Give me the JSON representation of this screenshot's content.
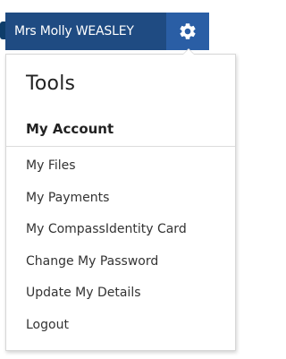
{
  "header": {
    "user_name": "Mrs Molly WEASLEY",
    "settings_icon": "gear-icon"
  },
  "dropdown": {
    "title": "Tools",
    "section_heading": "My Account",
    "items": [
      {
        "label": "My Files"
      },
      {
        "label": "My Payments"
      },
      {
        "label": "My CompassIdentity Card"
      },
      {
        "label": "Change My Password"
      },
      {
        "label": "Update My Details"
      },
      {
        "label": "Logout"
      }
    ]
  },
  "colors": {
    "header_bg": "#1f4b82",
    "gear_bg": "#2a5ea5",
    "text": "#333333"
  }
}
